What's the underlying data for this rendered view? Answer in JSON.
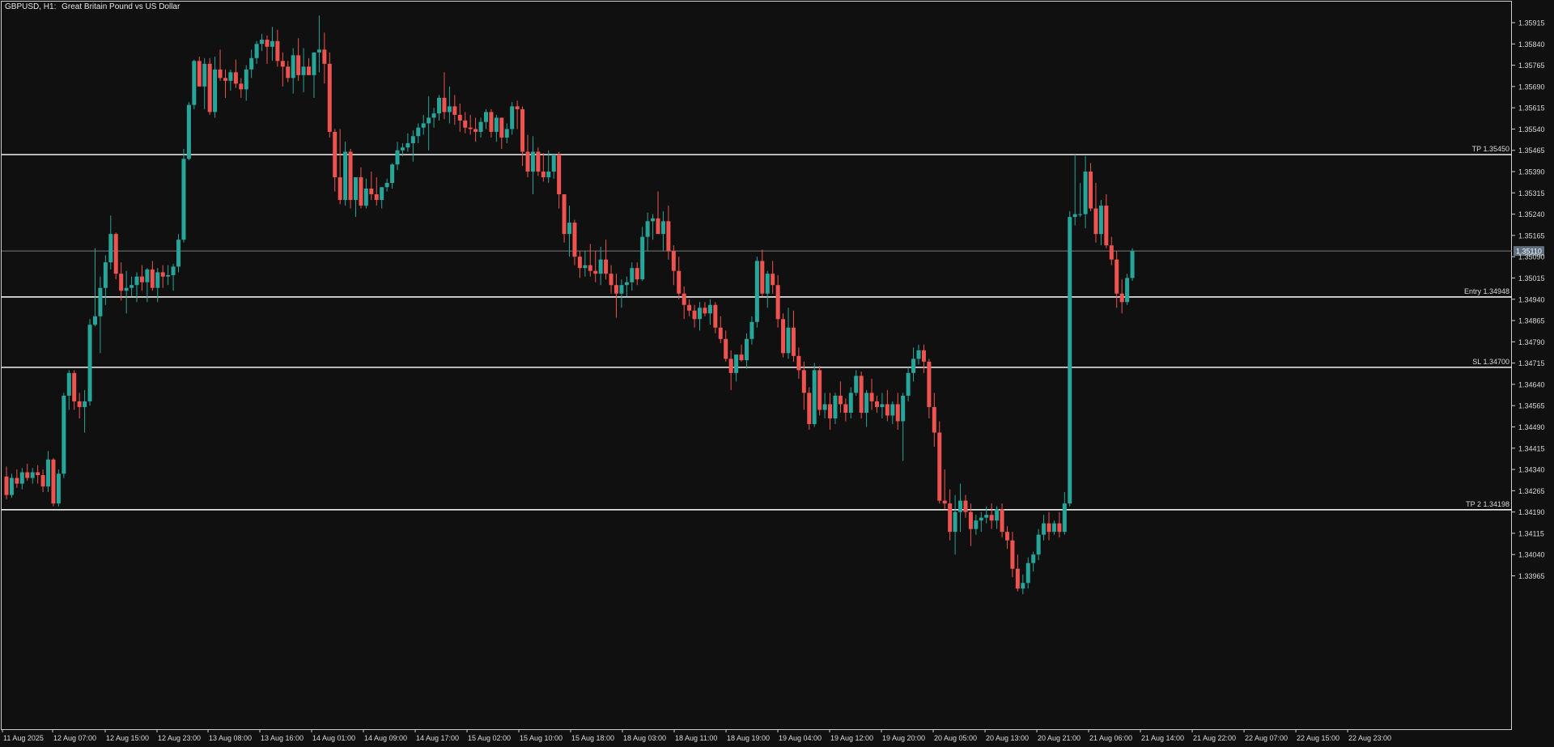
{
  "header": {
    "symbol_timeframe": "GBPUSD, H1:",
    "description": "Great Britain Pound vs US Dollar"
  },
  "colors": {
    "background": "#101010",
    "frame": "#cfcfcf",
    "bull": "#26a69a",
    "bear": "#ef5350",
    "text": "#d9d9d9",
    "level_line": "#f0f0f0",
    "bid_line": "#7a7a7a",
    "bid_label_bg": "#5f6f80"
  },
  "chart_data": {
    "type": "candlestick",
    "title": "GBPUSD, H1: Great Britain Pound vs US Dollar",
    "ylim": [
      1.3389,
      1.3597
    ],
    "y_ticks": [
      "1.35915",
      "1.35840",
      "1.35765",
      "1.35690",
      "1.35615",
      "1.35540",
      "1.35465",
      "1.35390",
      "1.35315",
      "1.35240",
      "1.35165",
      "1.35090",
      "1.35015",
      "1.34940",
      "1.34865",
      "1.34790",
      "1.34715",
      "1.34640",
      "1.34565",
      "1.34490",
      "1.34415",
      "1.34340",
      "1.34265",
      "1.34190",
      "1.34115",
      "1.34040",
      "1.33965"
    ],
    "x_ticks": [
      "11 Aug 2025",
      "12 Aug 07:00",
      "12 Aug 15:00",
      "12 Aug 23:00",
      "13 Aug 08:00",
      "13 Aug 16:00",
      "14 Aug 01:00",
      "14 Aug 09:00",
      "14 Aug 17:00",
      "15 Aug 02:00",
      "15 Aug 10:00",
      "15 Aug 18:00",
      "18 Aug 03:00",
      "18 Aug 11:00",
      "18 Aug 19:00",
      "19 Aug 04:00",
      "19 Aug 12:00",
      "19 Aug 20:00",
      "20 Aug 05:00",
      "20 Aug 13:00",
      "20 Aug 21:00",
      "21 Aug 06:00",
      "21 Aug 14:00",
      "21 Aug 22:00",
      "22 Aug 07:00",
      "22 Aug 15:00",
      "22 Aug 23:00"
    ],
    "current_price": "1.35110",
    "levels": [
      {
        "label": "TP 1.35450",
        "value": 1.3545
      },
      {
        "label": "Entry 1.34948",
        "value": 1.34948
      },
      {
        "label": "SL 1.34700",
        "value": 1.347
      },
      {
        "label": "TP 2 1.34198",
        "value": 1.34198
      }
    ],
    "candles": [
      [
        1.34315,
        1.3435,
        1.34235,
        1.3425
      ],
      [
        1.3425,
        1.34325,
        1.3424,
        1.3431
      ],
      [
        1.3431,
        1.3434,
        1.34275,
        1.3429
      ],
      [
        1.3429,
        1.34345,
        1.3427,
        1.3433
      ],
      [
        1.3433,
        1.3436,
        1.343,
        1.3431
      ],
      [
        1.3431,
        1.34345,
        1.3429,
        1.3433
      ],
      [
        1.3433,
        1.34355,
        1.3429,
        1.3432
      ],
      [
        1.3432,
        1.3434,
        1.3426,
        1.3428
      ],
      [
        1.3428,
        1.34405,
        1.3426,
        1.34375
      ],
      [
        1.34375,
        1.3438,
        1.3421,
        1.3422
      ],
      [
        1.3422,
        1.3434,
        1.3421,
        1.34325
      ],
      [
        1.34325,
        1.3461,
        1.3431,
        1.346
      ],
      [
        1.346,
        1.3469,
        1.3455,
        1.3468
      ],
      [
        1.3468,
        1.3469,
        1.3455,
        1.3458
      ],
      [
        1.3458,
        1.3461,
        1.3452,
        1.3456
      ],
      [
        1.3456,
        1.3462,
        1.3447,
        1.3458
      ],
      [
        1.3458,
        1.3487,
        1.34565,
        1.3485
      ],
      [
        1.3485,
        1.3512,
        1.34845,
        1.3488
      ],
      [
        1.3488,
        1.3502,
        1.3475,
        1.3498
      ],
      [
        1.3498,
        1.35095,
        1.3492,
        1.3507
      ],
      [
        1.3507,
        1.35235,
        1.35045,
        1.3517
      ],
      [
        1.3517,
        1.35175,
        1.3501,
        1.3503
      ],
      [
        1.3503,
        1.3507,
        1.34935,
        1.3497
      ],
      [
        1.3497,
        1.3504,
        1.3489,
        1.3498
      ],
      [
        1.3498,
        1.3502,
        1.3495,
        1.3499
      ],
      [
        1.3499,
        1.35035,
        1.3493,
        1.3502
      ],
      [
        1.3502,
        1.3506,
        1.3497,
        1.35
      ],
      [
        1.35,
        1.3505,
        1.3493,
        1.35045
      ],
      [
        1.35045,
        1.35075,
        1.3497,
        1.3498
      ],
      [
        1.3498,
        1.3505,
        1.3493,
        1.35035
      ],
      [
        1.35035,
        1.3506,
        1.3498,
        1.3502
      ],
      [
        1.3502,
        1.3506,
        1.3499,
        1.35025
      ],
      [
        1.35025,
        1.35065,
        1.3497,
        1.35055
      ],
      [
        1.35055,
        1.3517,
        1.35035,
        1.3515
      ],
      [
        1.3515,
        1.3547,
        1.3514,
        1.35435
      ],
      [
        1.35435,
        1.35635,
        1.3543,
        1.35625
      ],
      [
        1.35625,
        1.35785,
        1.3561,
        1.3578
      ],
      [
        1.3578,
        1.35795,
        1.35715,
        1.3569
      ],
      [
        1.3569,
        1.3579,
        1.3561,
        1.3577
      ],
      [
        1.3577,
        1.3579,
        1.3559,
        1.356
      ],
      [
        1.356,
        1.35795,
        1.3558,
        1.3575
      ],
      [
        1.3575,
        1.3582,
        1.3571,
        1.3572
      ],
      [
        1.3572,
        1.3575,
        1.3565,
        1.3571
      ],
      [
        1.3571,
        1.3575,
        1.35675,
        1.3574
      ],
      [
        1.3574,
        1.35785,
        1.35685,
        1.357
      ],
      [
        1.357,
        1.3572,
        1.3565,
        1.3568
      ],
      [
        1.3568,
        1.35765,
        1.3564,
        1.3575
      ],
      [
        1.3575,
        1.3582,
        1.3572,
        1.3579
      ],
      [
        1.3579,
        1.3585,
        1.3577,
        1.3584
      ],
      [
        1.3584,
        1.35875,
        1.35815,
        1.35855
      ],
      [
        1.35855,
        1.3587,
        1.3577,
        1.3583
      ],
      [
        1.3583,
        1.359,
        1.3578,
        1.3585
      ],
      [
        1.3585,
        1.3589,
        1.3576,
        1.3578
      ],
      [
        1.3578,
        1.3581,
        1.3569,
        1.3576
      ],
      [
        1.3576,
        1.3578,
        1.35705,
        1.3572
      ],
      [
        1.3572,
        1.35825,
        1.35665,
        1.358
      ],
      [
        1.358,
        1.3586,
        1.3571,
        1.3573
      ],
      [
        1.3573,
        1.35825,
        1.3567,
        1.3576
      ],
      [
        1.3576,
        1.3579,
        1.3573,
        1.3573
      ],
      [
        1.3573,
        1.3579,
        1.3565,
        1.3581
      ],
      [
        1.3581,
        1.3594,
        1.3574,
        1.3582
      ],
      [
        1.3582,
        1.3588,
        1.357,
        1.3577
      ],
      [
        1.3577,
        1.3581,
        1.3551,
        1.3553
      ],
      [
        1.3553,
        1.3554,
        1.3532,
        1.3537
      ],
      [
        1.3537,
        1.3554,
        1.35275,
        1.3529
      ],
      [
        1.3529,
        1.35495,
        1.3527,
        1.3546
      ],
      [
        1.3546,
        1.3547,
        1.3526,
        1.3529
      ],
      [
        1.3529,
        1.3537,
        1.3523,
        1.3537
      ],
      [
        1.3537,
        1.35405,
        1.3526,
        1.3527
      ],
      [
        1.3527,
        1.35365,
        1.3526,
        1.3533
      ],
      [
        1.3533,
        1.3539,
        1.3529,
        1.3531
      ],
      [
        1.3531,
        1.3537,
        1.3527,
        1.3529
      ],
      [
        1.3529,
        1.3533,
        1.3526,
        1.35335
      ],
      [
        1.35335,
        1.35365,
        1.3532,
        1.3535
      ],
      [
        1.3535,
        1.3542,
        1.3533,
        1.35415
      ],
      [
        1.35415,
        1.35495,
        1.35395,
        1.35465
      ],
      [
        1.35465,
        1.3549,
        1.35445,
        1.35475
      ],
      [
        1.35475,
        1.35525,
        1.3546,
        1.3549
      ],
      [
        1.3549,
        1.35535,
        1.35425,
        1.35515
      ],
      [
        1.35515,
        1.3556,
        1.3549,
        1.35545
      ],
      [
        1.35545,
        1.3559,
        1.3552,
        1.3556
      ],
      [
        1.3556,
        1.35655,
        1.35465,
        1.3558
      ],
      [
        1.3558,
        1.35615,
        1.35545,
        1.35595
      ],
      [
        1.35595,
        1.3566,
        1.3557,
        1.3565
      ],
      [
        1.3565,
        1.3574,
        1.35575,
        1.356
      ],
      [
        1.356,
        1.3569,
        1.3556,
        1.3562
      ],
      [
        1.3562,
        1.3566,
        1.35555,
        1.3559
      ],
      [
        1.3559,
        1.3563,
        1.3553,
        1.3557
      ],
      [
        1.3557,
        1.356,
        1.35525,
        1.35545
      ],
      [
        1.35545,
        1.3559,
        1.3552,
        1.3554
      ],
      [
        1.3554,
        1.3558,
        1.35495,
        1.3553
      ],
      [
        1.3553,
        1.3558,
        1.3551,
        1.35565
      ],
      [
        1.35565,
        1.3561,
        1.3554,
        1.356
      ],
      [
        1.356,
        1.3561,
        1.3551,
        1.3553
      ],
      [
        1.3553,
        1.3559,
        1.35495,
        1.3558
      ],
      [
        1.3558,
        1.3558,
        1.3547,
        1.3551
      ],
      [
        1.3551,
        1.3556,
        1.3549,
        1.3554
      ],
      [
        1.3554,
        1.35635,
        1.3552,
        1.3562
      ],
      [
        1.3562,
        1.3564,
        1.3554,
        1.3561
      ],
      [
        1.3561,
        1.3562,
        1.3541,
        1.3546
      ],
      [
        1.3546,
        1.3552,
        1.3537,
        1.3539
      ],
      [
        1.3539,
        1.35515,
        1.3531,
        1.3546
      ],
      [
        1.3546,
        1.35475,
        1.35375,
        1.3539
      ],
      [
        1.3539,
        1.35455,
        1.35355,
        1.3537
      ],
      [
        1.3537,
        1.35465,
        1.3535,
        1.3539
      ],
      [
        1.3539,
        1.35425,
        1.35365,
        1.3545
      ],
      [
        1.3545,
        1.3546,
        1.3526,
        1.3531
      ],
      [
        1.3531,
        1.3531,
        1.3514,
        1.3517
      ],
      [
        1.3517,
        1.3527,
        1.3509,
        1.3521
      ],
      [
        1.3521,
        1.3522,
        1.3506,
        1.3509
      ],
      [
        1.3509,
        1.3511,
        1.35015,
        1.3505
      ],
      [
        1.3505,
        1.3511,
        1.3502,
        1.3506
      ],
      [
        1.3506,
        1.35135,
        1.3502,
        1.3504
      ],
      [
        1.3504,
        1.3511,
        1.35,
        1.3503
      ],
      [
        1.3503,
        1.35125,
        1.3499,
        1.3508
      ],
      [
        1.3508,
        1.3515,
        1.3501,
        1.3503
      ],
      [
        1.3503,
        1.3506,
        1.3496,
        1.3499
      ],
      [
        1.3499,
        1.3503,
        1.34875,
        1.3496
      ],
      [
        1.3496,
        1.3501,
        1.3491,
        1.3499
      ],
      [
        1.3499,
        1.3502,
        1.3495,
        1.35
      ],
      [
        1.35,
        1.3507,
        1.3497,
        1.3505
      ],
      [
        1.3505,
        1.3507,
        1.3499,
        1.3501
      ],
      [
        1.3501,
        1.35195,
        1.35005,
        1.3516
      ],
      [
        1.3516,
        1.35245,
        1.3511,
        1.35215
      ],
      [
        1.35215,
        1.3524,
        1.3515,
        1.35225
      ],
      [
        1.35225,
        1.3532,
        1.3518,
        1.3517
      ],
      [
        1.3517,
        1.3525,
        1.3511,
        1.35215
      ],
      [
        1.35215,
        1.3527,
        1.3508,
        1.3511
      ],
      [
        1.3511,
        1.3513,
        1.3499,
        1.3504
      ],
      [
        1.3504,
        1.3509,
        1.3494,
        1.3496
      ],
      [
        1.3496,
        1.34985,
        1.3487,
        1.3492
      ],
      [
        1.3492,
        1.3494,
        1.3488,
        1.349
      ],
      [
        1.349,
        1.3492,
        1.3484,
        1.3487
      ],
      [
        1.3487,
        1.3493,
        1.3483,
        1.3491
      ],
      [
        1.3491,
        1.3493,
        1.3488,
        1.3489
      ],
      [
        1.3489,
        1.3494,
        1.3485,
        1.3492
      ],
      [
        1.3492,
        1.3493,
        1.3482,
        1.3484
      ],
      [
        1.3484,
        1.3488,
        1.34785,
        1.348
      ],
      [
        1.348,
        1.3483,
        1.3472,
        1.3473
      ],
      [
        1.3473,
        1.3476,
        1.3462,
        1.3468
      ],
      [
        1.3468,
        1.3474,
        1.3465,
        1.34745
      ],
      [
        1.34745,
        1.3478,
        1.3472,
        1.34725
      ],
      [
        1.34725,
        1.3482,
        1.34695,
        1.348
      ],
      [
        1.348,
        1.3488,
        1.3478,
        1.3486
      ],
      [
        1.3486,
        1.3509,
        1.3484,
        1.35075
      ],
      [
        1.35075,
        1.35115,
        1.3495,
        1.3496
      ],
      [
        1.3496,
        1.3504,
        1.3491,
        1.3503
      ],
      [
        1.3503,
        1.35075,
        1.3496,
        1.3499
      ],
      [
        1.3499,
        1.35025,
        1.3484,
        1.3487
      ],
      [
        1.3487,
        1.3489,
        1.34735,
        1.3475
      ],
      [
        1.3475,
        1.3491,
        1.3473,
        1.3484
      ],
      [
        1.3484,
        1.349,
        1.3472,
        1.3474
      ],
      [
        1.3474,
        1.3477,
        1.3466,
        1.3469
      ],
      [
        1.3469,
        1.3472,
        1.3455,
        1.3461
      ],
      [
        1.3461,
        1.3463,
        1.3448,
        1.345
      ],
      [
        1.345,
        1.34715,
        1.3449,
        1.3469
      ],
      [
        1.3469,
        1.34705,
        1.3453,
        1.3455
      ],
      [
        1.3455,
        1.3461,
        1.3452,
        1.3457
      ],
      [
        1.3457,
        1.3461,
        1.3448,
        1.3452
      ],
      [
        1.3452,
        1.3461,
        1.345,
        1.346
      ],
      [
        1.346,
        1.3465,
        1.3454,
        1.3457
      ],
      [
        1.3457,
        1.3459,
        1.3451,
        1.3454
      ],
      [
        1.3454,
        1.3463,
        1.3452,
        1.3461
      ],
      [
        1.3461,
        1.3469,
        1.346,
        1.3467
      ],
      [
        1.3467,
        1.34685,
        1.3452,
        1.3454
      ],
      [
        1.3454,
        1.3462,
        1.3449,
        1.3461
      ],
      [
        1.3461,
        1.3466,
        1.3455,
        1.3458
      ],
      [
        1.3458,
        1.346,
        1.3454,
        1.3456
      ],
      [
        1.3456,
        1.3461,
        1.3452,
        1.3457
      ],
      [
        1.3457,
        1.3462,
        1.3451,
        1.3453
      ],
      [
        1.3453,
        1.3458,
        1.345,
        1.3457
      ],
      [
        1.3457,
        1.3461,
        1.3448,
        1.3451
      ],
      [
        1.3451,
        1.3461,
        1.3437,
        1.346
      ],
      [
        1.346,
        1.347,
        1.3458,
        1.3468
      ],
      [
        1.3468,
        1.3477,
        1.3465,
        1.3473
      ],
      [
        1.3473,
        1.3478,
        1.3471,
        1.3476
      ],
      [
        1.3476,
        1.3478,
        1.3468,
        1.3472
      ],
      [
        1.3472,
        1.3473,
        1.3452,
        1.3456
      ],
      [
        1.3456,
        1.3461,
        1.3442,
        1.3447
      ],
      [
        1.3447,
        1.3451,
        1.3422,
        1.3423
      ],
      [
        1.3423,
        1.3434,
        1.342,
        1.3422
      ],
      [
        1.3422,
        1.3427,
        1.3409,
        1.3412
      ],
      [
        1.3412,
        1.3425,
        1.3404,
        1.3419
      ],
      [
        1.3419,
        1.3429,
        1.3412,
        1.3423
      ],
      [
        1.3423,
        1.3425,
        1.3417,
        1.3419
      ],
      [
        1.3419,
        1.3422,
        1.3407,
        1.3413
      ],
      [
        1.3413,
        1.3418,
        1.3411,
        1.3416
      ],
      [
        1.3416,
        1.3419,
        1.3412,
        1.3417
      ],
      [
        1.3417,
        1.3421,
        1.3415,
        1.3418
      ],
      [
        1.3418,
        1.3422,
        1.3413,
        1.3416
      ],
      [
        1.3416,
        1.3421,
        1.3413,
        1.342
      ],
      [
        1.342,
        1.3422,
        1.341,
        1.3412
      ],
      [
        1.3412,
        1.3414,
        1.3406,
        1.3409
      ],
      [
        1.3409,
        1.3412,
        1.3396,
        1.3399
      ],
      [
        1.3399,
        1.3404,
        1.3391,
        1.3392
      ],
      [
        1.3392,
        1.3397,
        1.339,
        1.3394
      ],
      [
        1.3394,
        1.3403,
        1.3392,
        1.3401
      ],
      [
        1.3401,
        1.3405,
        1.3398,
        1.3404
      ],
      [
        1.3404,
        1.3413,
        1.3402,
        1.3411
      ],
      [
        1.3411,
        1.3418,
        1.3409,
        1.3415
      ],
      [
        1.3415,
        1.3419,
        1.3409,
        1.3412
      ],
      [
        1.3412,
        1.3416,
        1.3411,
        1.3415
      ],
      [
        1.3415,
        1.3419,
        1.341,
        1.3412
      ],
      [
        1.3412,
        1.3426,
        1.3411,
        1.3422
      ],
      [
        1.3422,
        1.3525,
        1.3421,
        1.3523
      ],
      [
        1.3523,
        1.3545,
        1.352,
        1.3524
      ],
      [
        1.3524,
        1.3535,
        1.3523,
        1.3524
      ],
      [
        1.3524,
        1.35445,
        1.3519,
        1.3539
      ],
      [
        1.3539,
        1.3542,
        1.3525,
        1.3526
      ],
      [
        1.3526,
        1.3535,
        1.3514,
        1.3517
      ],
      [
        1.3517,
        1.3529,
        1.3513,
        1.3527
      ],
      [
        1.3527,
        1.3531,
        1.3512,
        1.3513
      ],
      [
        1.3513,
        1.3516,
        1.3506,
        1.3508
      ],
      [
        1.3508,
        1.3511,
        1.3491,
        1.3496
      ],
      [
        1.3496,
        1.3501,
        1.3489,
        1.3493
      ],
      [
        1.3493,
        1.3503,
        1.3492,
        1.35015
      ],
      [
        1.35015,
        1.3512,
        1.35005,
        1.3511
      ]
    ]
  }
}
